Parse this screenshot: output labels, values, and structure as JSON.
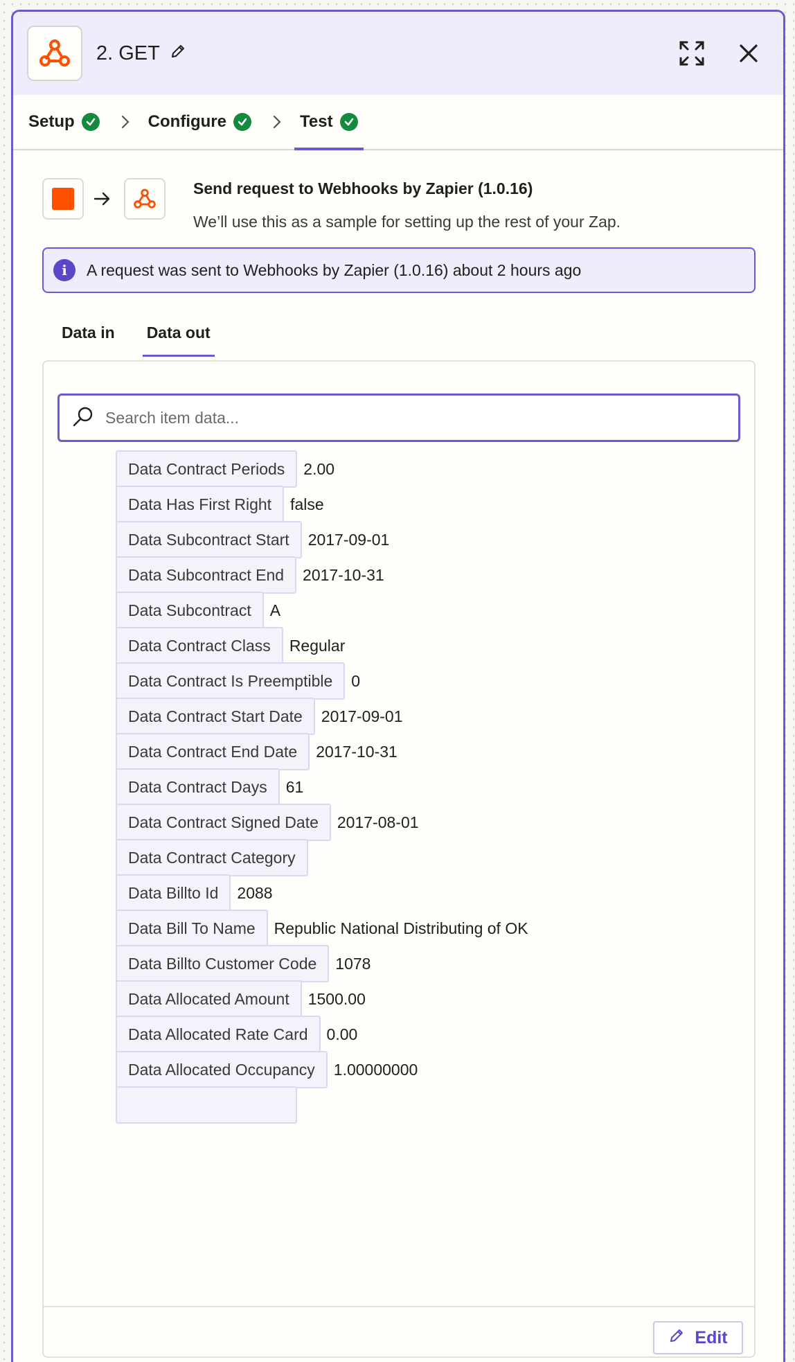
{
  "header": {
    "step_title": "2. GET",
    "icons": {
      "app": "webhook-icon",
      "rename": "pencil-icon",
      "expand": "expand-icon",
      "close": "close-icon"
    }
  },
  "tabs": [
    {
      "label": "Setup",
      "status": "complete"
    },
    {
      "label": "Configure",
      "status": "complete"
    },
    {
      "label": "Test",
      "status": "complete",
      "active": true
    }
  ],
  "summary": {
    "title": "Send request to Webhooks by Zapier (1.0.16)",
    "subtitle": "We’ll use this as a sample for setting up the rest of your Zap."
  },
  "info": {
    "text": "A request was sent to Webhooks by Zapier (1.0.16) about 2 hours ago",
    "icon": "info-icon"
  },
  "data_tabs": {
    "in_label": "Data in",
    "out_label": "Data out",
    "active": "Data out"
  },
  "search": {
    "placeholder": "Search item data...",
    "value": ""
  },
  "rows": [
    {
      "key": "Data Contract Periods",
      "value": "2.00"
    },
    {
      "key": "Data Has First Right",
      "value": "false"
    },
    {
      "key": "Data Subcontract Start",
      "value": "2017-09-01"
    },
    {
      "key": "Data Subcontract End",
      "value": "2017-10-31"
    },
    {
      "key": "Data Subcontract",
      "value": "A"
    },
    {
      "key": "Data Contract Class",
      "value": "Regular"
    },
    {
      "key": "Data Contract Is Preemptible",
      "value": "0"
    },
    {
      "key": "Data Contract Start Date",
      "value": "2017-09-01"
    },
    {
      "key": "Data Contract End Date",
      "value": "2017-10-31"
    },
    {
      "key": "Data Contract Days",
      "value": "61"
    },
    {
      "key": "Data Contract Signed Date",
      "value": "2017-08-01"
    },
    {
      "key": "Data Contract Category",
      "value": ""
    },
    {
      "key": "Data Billto Id",
      "value": "2088"
    },
    {
      "key": "Data Bill To Name",
      "value": "Republic National Distributing of OK"
    },
    {
      "key": "Data Billto Customer Code",
      "value": "1078"
    },
    {
      "key": "Data Allocated Amount",
      "value": "1500.00"
    },
    {
      "key": "Data Allocated Rate Card",
      "value": "0.00"
    },
    {
      "key": "Data Allocated Occupancy",
      "value": "1.00000000"
    }
  ],
  "footer": {
    "edit_label": "Edit"
  },
  "colors": {
    "accent": "#6a5acd",
    "success": "#138a3e",
    "brand": "#ff4f00"
  }
}
